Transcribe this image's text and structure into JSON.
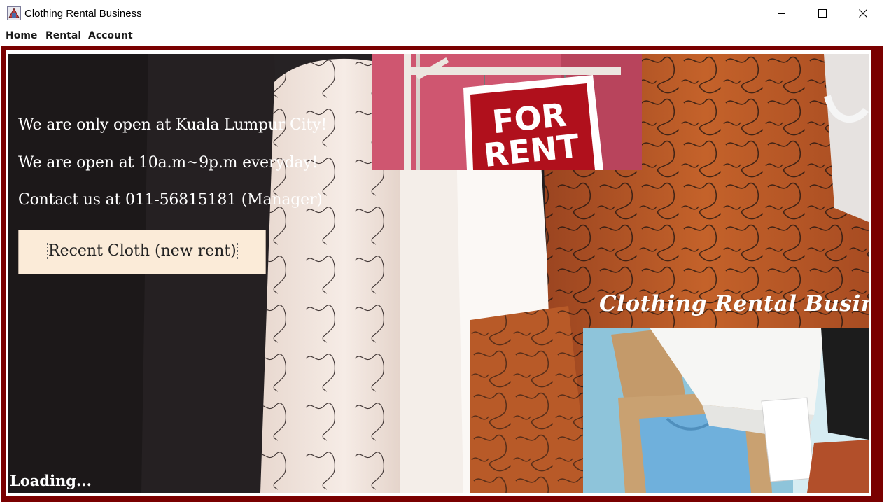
{
  "window": {
    "title": "Clothing Rental Business"
  },
  "menu": {
    "items": [
      "Home",
      "Rental",
      "Account"
    ]
  },
  "info": {
    "line1": "We are only open at Kuala Lumpur City!",
    "line2": "We are open at 10a.m~9p.m everyday!",
    "line3": "Contact us at 011-56815181 (Manager)"
  },
  "recent_button": {
    "label": "Recent Cloth (new rent)"
  },
  "sign": {
    "line1": "FOR",
    "line2": "RENT"
  },
  "brand": "Clothing Rental Business",
  "status": "Loading...",
  "colors": {
    "frame": "#7a0000",
    "button_bg": "#fbebd8",
    "sign_red": "#b0101c"
  }
}
